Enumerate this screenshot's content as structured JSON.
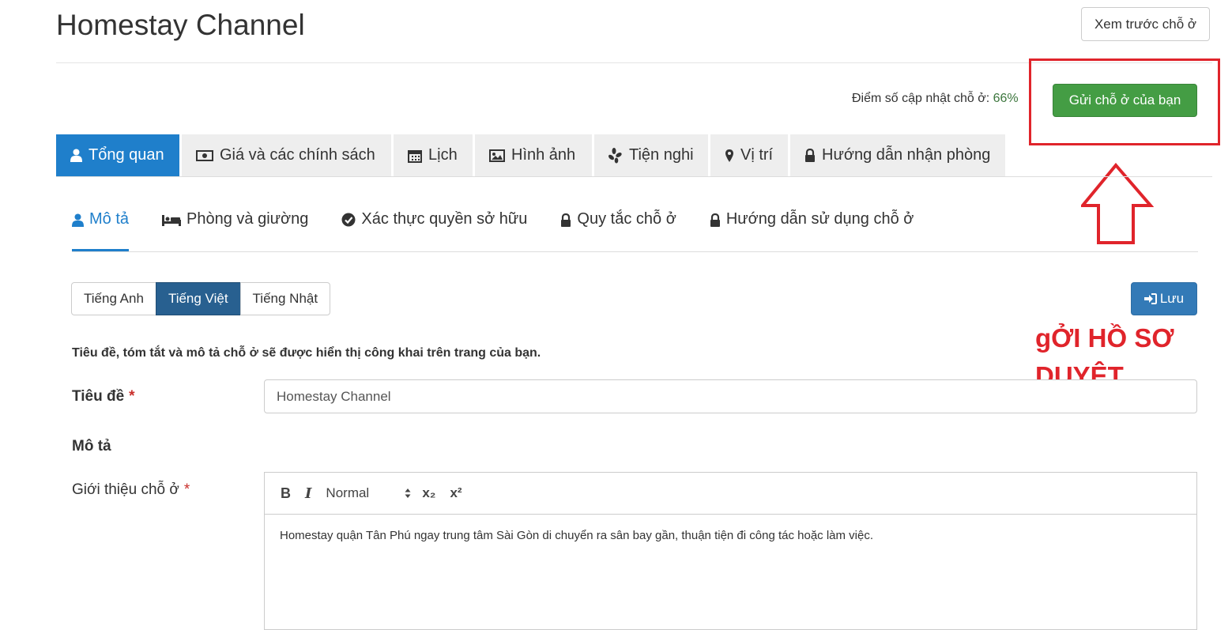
{
  "header": {
    "title": "Homestay Channel",
    "preview_label": "Xem trước chỗ ở"
  },
  "score": {
    "label": "Điểm số cập nhật chỗ ở: ",
    "value": "66%"
  },
  "submit_label": "Gửi chỗ ở của bạn",
  "annotation": {
    "line1": "gỞI HỒ SƠ",
    "line2": "DUYỆT",
    "color": "#e0242b"
  },
  "main_tabs": [
    {
      "label": "Tổng quan",
      "icon": "user-icon",
      "active": true
    },
    {
      "label": "Giá và các chính sách",
      "icon": "money-icon",
      "active": false
    },
    {
      "label": "Lịch",
      "icon": "calendar-icon",
      "active": false
    },
    {
      "label": "Hình ảnh",
      "icon": "image-icon",
      "active": false
    },
    {
      "label": "Tiện nghi",
      "icon": "amenities-icon",
      "active": false
    },
    {
      "label": "Vị trí",
      "icon": "map-marker-icon",
      "active": false
    },
    {
      "label": "Hướng dẫn nhận phòng",
      "icon": "lock-icon",
      "active": false
    }
  ],
  "sub_tabs": [
    {
      "label": "Mô tả",
      "icon": "user-icon",
      "active": true
    },
    {
      "label": "Phòng và giường",
      "icon": "bed-icon",
      "active": false
    },
    {
      "label": "Xác thực quyền sở hữu",
      "icon": "check-circle-icon",
      "active": false
    },
    {
      "label": "Quy tắc chỗ ở",
      "icon": "lock-icon",
      "active": false
    },
    {
      "label": "Hướng dẫn sử dụng chỗ ở",
      "icon": "lock-icon",
      "active": false
    }
  ],
  "languages": [
    {
      "label": "Tiếng Anh",
      "active": false
    },
    {
      "label": "Tiếng Việt",
      "active": true
    },
    {
      "label": "Tiếng Nhật",
      "active": false
    }
  ],
  "save_label": "Lưu",
  "note": "Tiêu đề, tóm tắt và mô tả chỗ ở sẽ được hiển thị công khai trên trang của bạn.",
  "form": {
    "title_label": "Tiêu đề",
    "title_value": "Homestay Channel",
    "required_mark": "*",
    "description_label": "Mô tả",
    "intro_label": "Giới thiệu chỗ ở",
    "editor": {
      "bold": "B",
      "italic": "I",
      "format": "Normal",
      "subscript": "x₂",
      "superscript": "x²",
      "content": "Homestay quận Tân Phú ngay trung tâm Sài Gòn di chuyển ra sân bay gần, thuận tiện đi công tác hoặc làm việc."
    }
  },
  "colors": {
    "primary": "#1f7fcb",
    "success": "#449d44",
    "score_green": "#3c763d",
    "annotation_red": "#e0242b"
  }
}
